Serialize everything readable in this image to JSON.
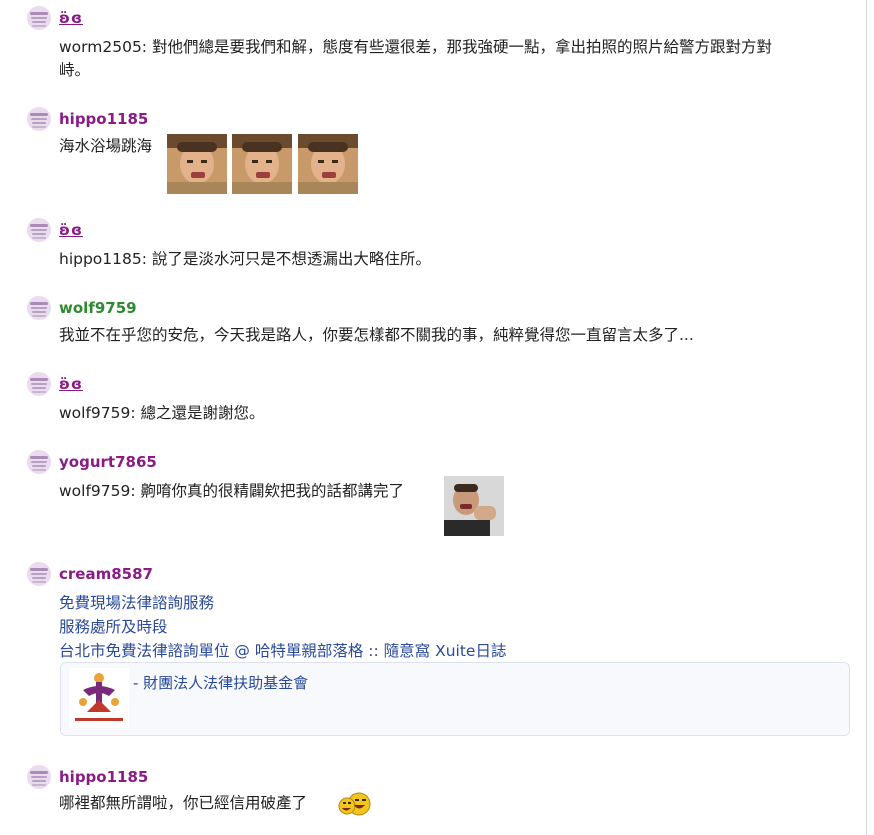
{
  "comments": [
    {
      "user": "ʚ̈ɞ",
      "text": "worm2505: 對他們總是要我們和解，態度有些還很差，那我強硬一點，拿出拍照的照片給警方跟對方對",
      "text_line2": "峙。"
    },
    {
      "user": "hippo1185",
      "text": "海水浴場跳海"
    },
    {
      "user": "ʚ̈ɞ",
      "text": "hippo1185: 說了是淡水河只是不想透漏出大略住所。"
    },
    {
      "user": "wolf9759",
      "text": "我並不在乎您的安危，今天我是路人，你要怎樣都不關我的事，純粹覺得您一直留言太多了..."
    },
    {
      "user": "ʚ̈ɞ",
      "text": "wolf9759: 總之還是謝謝您。"
    },
    {
      "user": "yogurt7865",
      "text": "wolf9759: 齁唷你真的很精闢欸把我的話都講完了"
    },
    {
      "user": "cream8587",
      "links": [
        "免費現場法律諮詢服務",
        "服務處所及時段",
        "台北市免費法律諮詢單位 @ 哈特單親部落格 :: 隨意窩 Xuite日誌"
      ],
      "card_title": "- 財團法人法律扶助基金會"
    },
    {
      "user": "hippo1185",
      "text": "哪裡都無所謂啦，你已經信用破產了"
    }
  ],
  "colors": {
    "username": "#8a1b86",
    "username_green": "#2f8a2f",
    "link": "#2a4a9a",
    "text": "#222222"
  }
}
